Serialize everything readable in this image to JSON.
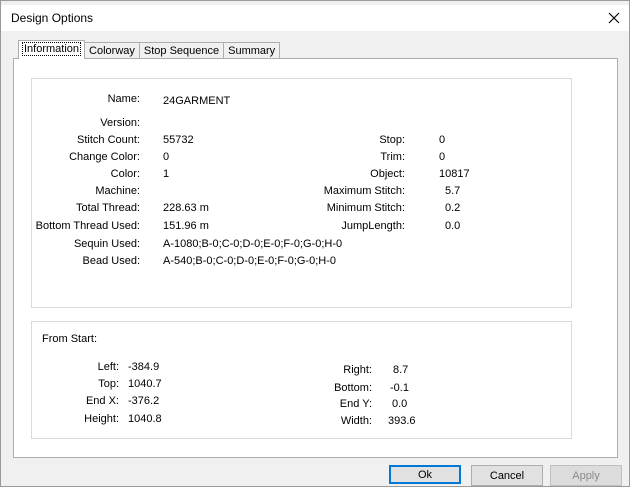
{
  "window": {
    "title": "Design Options"
  },
  "tabs": [
    {
      "label": "Information",
      "active": true
    },
    {
      "label": "Colorway",
      "active": false
    },
    {
      "label": "Stop Sequence",
      "active": false
    },
    {
      "label": "Summary",
      "active": false
    }
  ],
  "info": {
    "name_label": "Name:",
    "name": "24GARMENT",
    "version_label": "Version:",
    "version": "",
    "stitch_count_label": "Stitch Count:",
    "stitch_count": "55732",
    "change_color_label": "Change Color:",
    "change_color": "0",
    "color_label": "Color:",
    "color": "1",
    "machine_label": "Machine:",
    "machine": "",
    "total_thread_label": "Total Thread:",
    "total_thread": "228.63 m",
    "bottom_thread_label": "Bottom Thread Used:",
    "bottom_thread": "151.96 m",
    "sequin_label": "Sequin Used:",
    "sequin": "A-1080;B-0;C-0;D-0;E-0;F-0;G-0;H-0",
    "bead_label": "Bead Used:",
    "bead": "A-540;B-0;C-0;D-0;E-0;F-0;G-0;H-0",
    "stop_label": "Stop:",
    "stop": "0",
    "trim_label": "Trim:",
    "trim": "0",
    "object_label": "Object:",
    "object": "10817",
    "max_stitch_label": "Maximum Stitch:",
    "max_stitch": "5.7",
    "min_stitch_label": "Minimum Stitch:",
    "min_stitch": "0.2",
    "jump_length_label": "JumpLength:",
    "jump_length": "0.0"
  },
  "from_start": {
    "heading": "From Start:",
    "left_label": "Left:",
    "left": "-384.9",
    "top_label": "Top:",
    "top": "1040.7",
    "end_x_label": "End X:",
    "end_x": "-376.2",
    "height_label": "Height:",
    "height": "1040.8",
    "right_label": "Right:",
    "right": "8.7",
    "bottom_label": "Bottom:",
    "bottom": "-0.1",
    "end_y_label": "End Y:",
    "end_y": "0.0",
    "width_label": "Width:",
    "width": "393.6"
  },
  "buttons": {
    "ok": "Ok",
    "cancel": "Cancel",
    "apply": "Apply"
  },
  "colors": {
    "focus_border": "#0078d7",
    "background_strip": "#5a8a3a"
  }
}
